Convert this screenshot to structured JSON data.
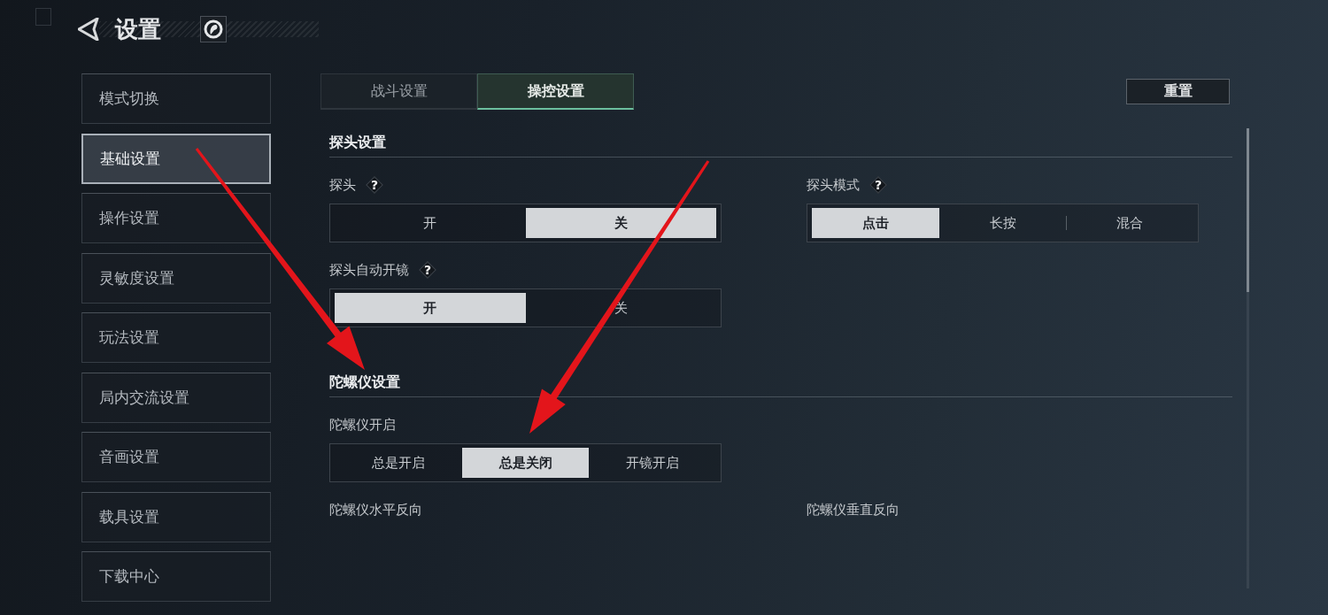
{
  "header": {
    "title": "设置"
  },
  "sidebar": {
    "items": [
      {
        "label": "模式切换",
        "selected": false
      },
      {
        "label": "基础设置",
        "selected": true
      },
      {
        "label": "操作设置",
        "selected": false
      },
      {
        "label": "灵敏度设置",
        "selected": false
      },
      {
        "label": "玩法设置",
        "selected": false
      },
      {
        "label": "局内交流设置",
        "selected": false
      },
      {
        "label": "音画设置",
        "selected": false
      },
      {
        "label": "载具设置",
        "selected": false
      },
      {
        "label": "下载中心",
        "selected": false
      }
    ]
  },
  "tabs": [
    {
      "label": "战斗设置",
      "selected": false
    },
    {
      "label": "操控设置",
      "selected": true
    }
  ],
  "reset_button": {
    "label": "重置"
  },
  "sections": [
    {
      "title": "探头设置",
      "rows": [
        {
          "settings": [
            {
              "label": "探头",
              "help": "?",
              "options": [
                {
                  "label": "开",
                  "selected": false
                },
                {
                  "label": "关",
                  "selected": true
                }
              ]
            },
            {
              "label": "探头模式",
              "help": "?",
              "options": [
                {
                  "label": "点击",
                  "selected": true
                },
                {
                  "label": "长按",
                  "selected": false
                },
                {
                  "label": "混合",
                  "selected": false
                }
              ]
            }
          ]
        },
        {
          "settings": [
            {
              "label": "探头自动开镜",
              "help": "?",
              "options": [
                {
                  "label": "开",
                  "selected": true
                },
                {
                  "label": "关",
                  "selected": false
                }
              ]
            }
          ]
        }
      ]
    },
    {
      "title": "陀螺仪设置",
      "rows": [
        {
          "settings": [
            {
              "label": "陀螺仪开启",
              "options": [
                {
                  "label": "总是开启",
                  "selected": false
                },
                {
                  "label": "总是关闭",
                  "selected": true
                },
                {
                  "label": "开镜开启",
                  "selected": false
                }
              ]
            }
          ]
        },
        {
          "settings": [
            {
              "label": "陀螺仪水平反向"
            },
            {
              "label": "陀螺仪垂直反向"
            }
          ]
        }
      ]
    }
  ]
}
